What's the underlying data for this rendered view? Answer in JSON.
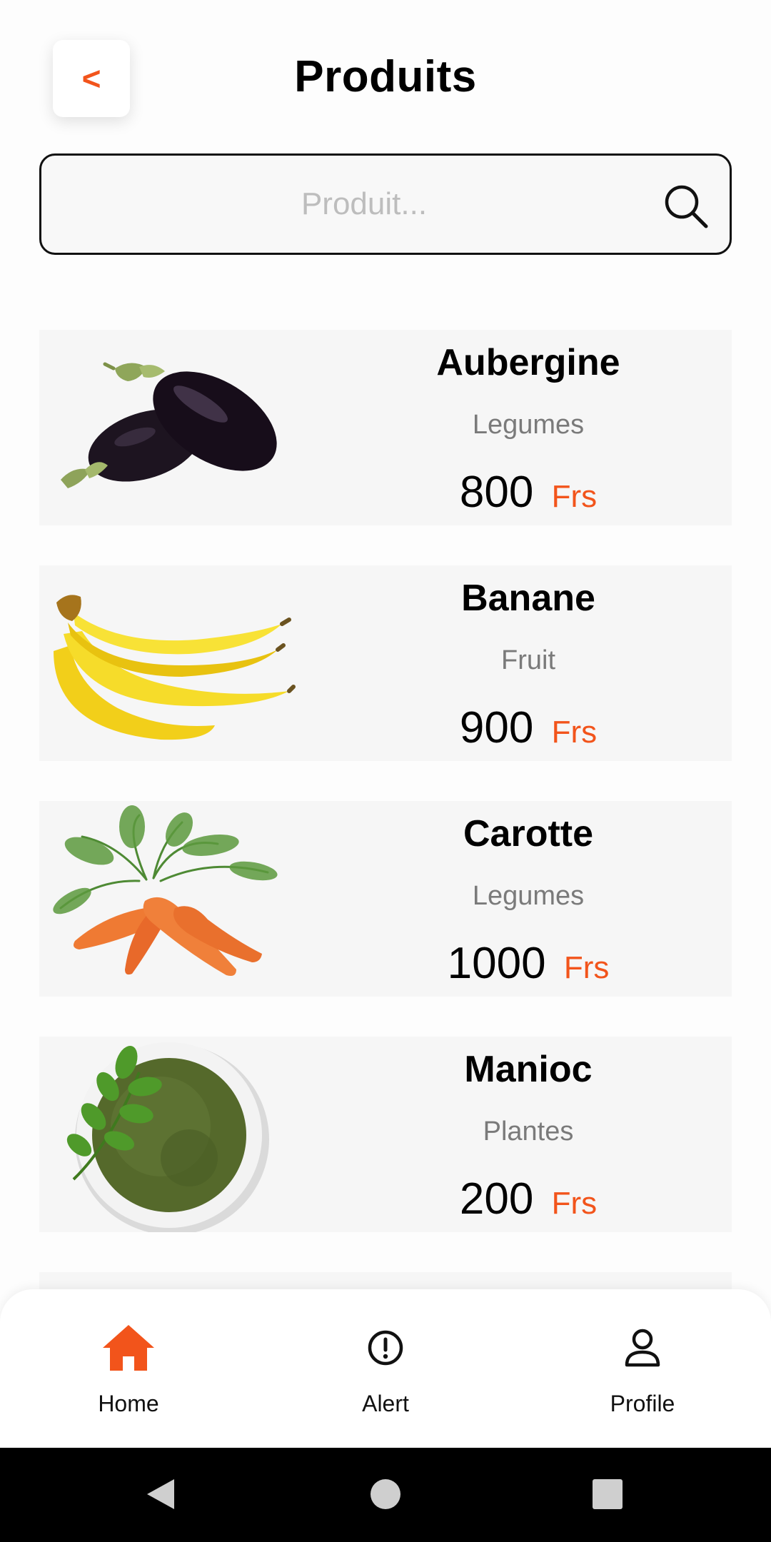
{
  "header": {
    "back_label": "<",
    "title": "Produits"
  },
  "search": {
    "placeholder": "Produit...",
    "value": ""
  },
  "products": [
    {
      "name": "Aubergine",
      "category": "Legumes",
      "price": "800",
      "currency": "Frs",
      "image_icon": "eggplant-image"
    },
    {
      "name": "Banane",
      "category": "Fruit",
      "price": "900",
      "currency": "Frs",
      "image_icon": "banana-image"
    },
    {
      "name": "Carotte",
      "category": "Legumes",
      "price": "1000",
      "currency": "Frs",
      "image_icon": "carrot-image"
    },
    {
      "name": "Manioc",
      "category": "Plantes",
      "price": "200",
      "currency": "Frs",
      "image_icon": "powder-bowl-image"
    }
  ],
  "bottom_nav": {
    "items": [
      {
        "label": "Home",
        "icon": "home-icon",
        "active": true
      },
      {
        "label": "Alert",
        "icon": "alert-icon",
        "active": false
      },
      {
        "label": "Profile",
        "icon": "profile-icon",
        "active": false
      }
    ]
  },
  "system_nav": {
    "back_icon": "system-back-icon",
    "home_icon": "system-home-icon",
    "recents_icon": "system-recents-icon"
  },
  "colors": {
    "accent": "#f2541b",
    "card_background": "#f6f6f6",
    "secondary_text": "#7a7a7a",
    "system_bar": "#000000"
  }
}
